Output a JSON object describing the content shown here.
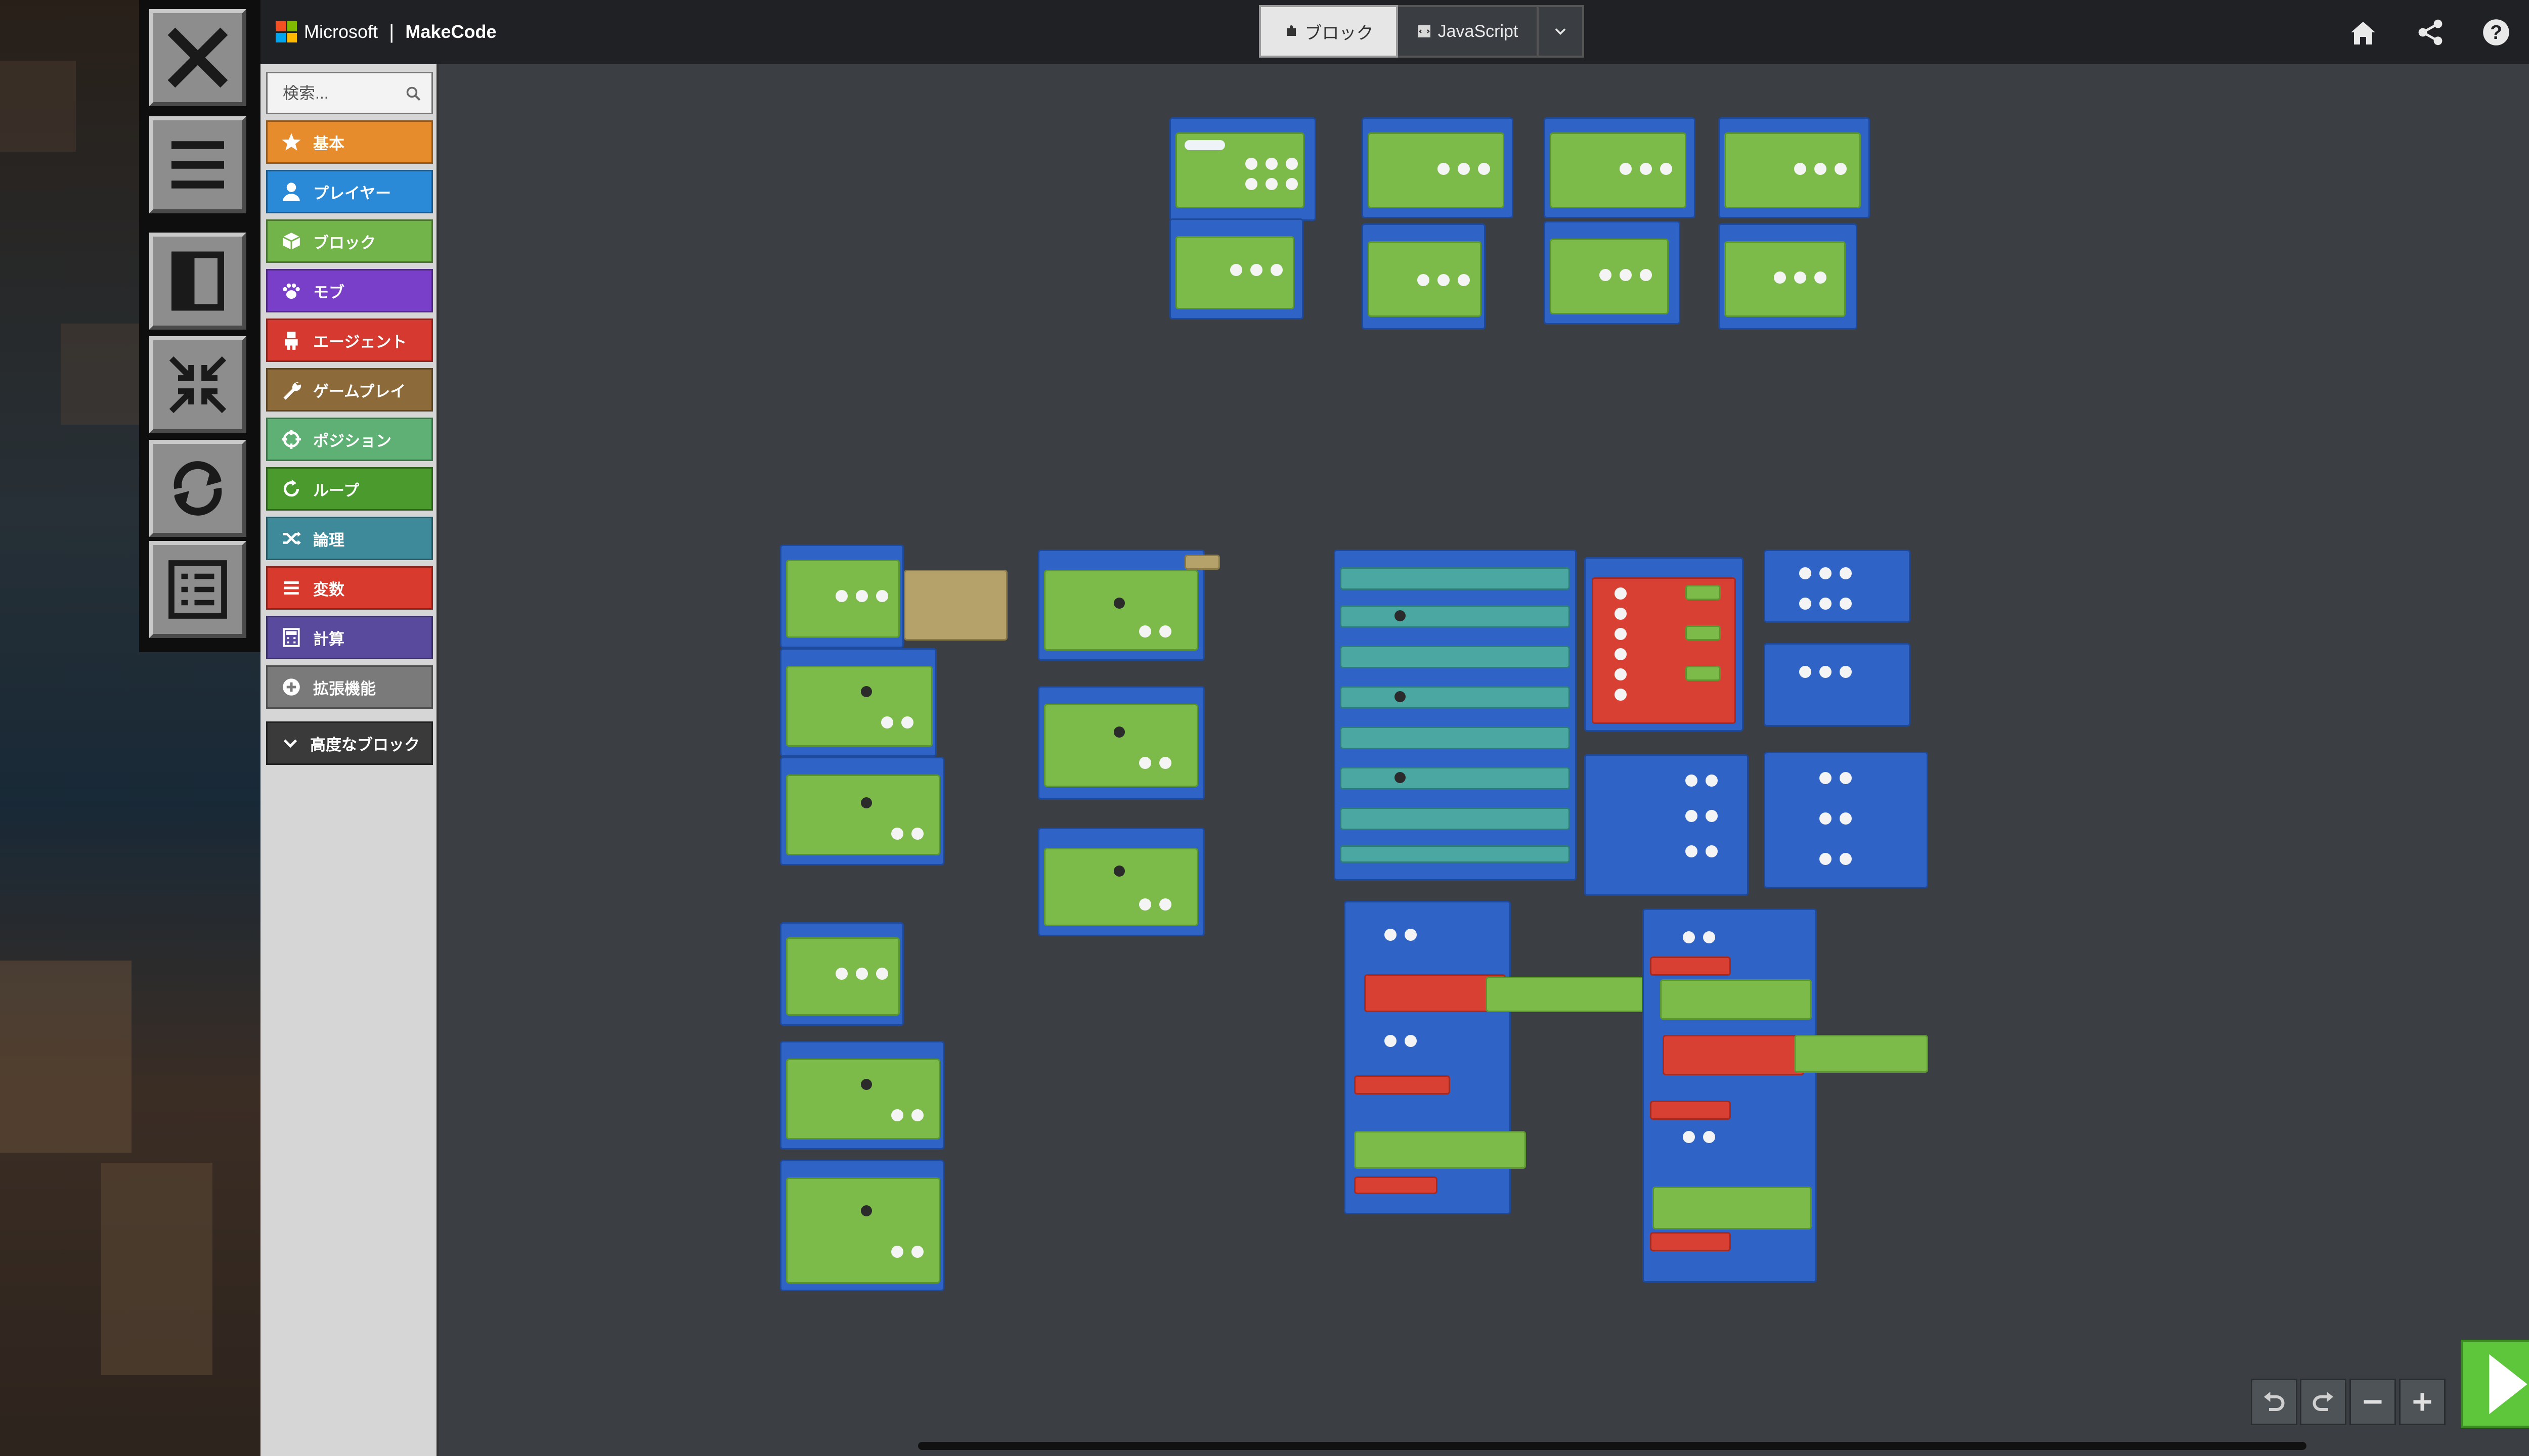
{
  "topbar": {
    "brand_company": "Microsoft",
    "brand_app": "MakeCode",
    "mode_blocks_label": "ブロック",
    "mode_js_label": "JavaScript"
  },
  "icons": {
    "home": "home-icon",
    "share": "share-icon",
    "help": "help-icon",
    "settings": "gear-icon"
  },
  "sidebar": {
    "search_placeholder": "検索...",
    "categories": [
      {
        "label": "基本",
        "color": "#e78c2c",
        "icon": "star-icon"
      },
      {
        "label": "プレイヤー",
        "color": "#2a8ad8",
        "icon": "player-icon"
      },
      {
        "label": "ブロック",
        "color": "#72b34a",
        "icon": "cube-icon"
      },
      {
        "label": "モブ",
        "color": "#7a3fc9",
        "icon": "paw-icon"
      },
      {
        "label": "エージェント",
        "color": "#d6392f",
        "icon": "agent-icon"
      },
      {
        "label": "ゲームプレイ",
        "color": "#8c6a3a",
        "icon": "wrench-icon"
      },
      {
        "label": "ポジション",
        "color": "#5fb074",
        "icon": "crosshair-icon"
      },
      {
        "label": "ループ",
        "color": "#4a9a2e",
        "icon": "loop-icon"
      },
      {
        "label": "論理",
        "color": "#3e8a9a",
        "icon": "shuffle-icon"
      },
      {
        "label": "変数",
        "color": "#d93a2e",
        "icon": "list-icon"
      },
      {
        "label": "計算",
        "color": "#5a4a9e",
        "icon": "calculator-icon"
      },
      {
        "label": "拡張機能",
        "color": "#7a7a7a",
        "icon": "plus-circle-icon"
      }
    ],
    "advanced_label": "高度なブロック"
  },
  "tools": [
    "close-icon",
    "menu-icon",
    "panel-icon",
    "collapse-icon",
    "reload-icon",
    "list-icon"
  ],
  "controls": {
    "undo": "undo-icon",
    "redo": "redo-icon",
    "zoom_out": "minus-icon",
    "zoom_in": "plus-icon",
    "run": "play-icon"
  }
}
